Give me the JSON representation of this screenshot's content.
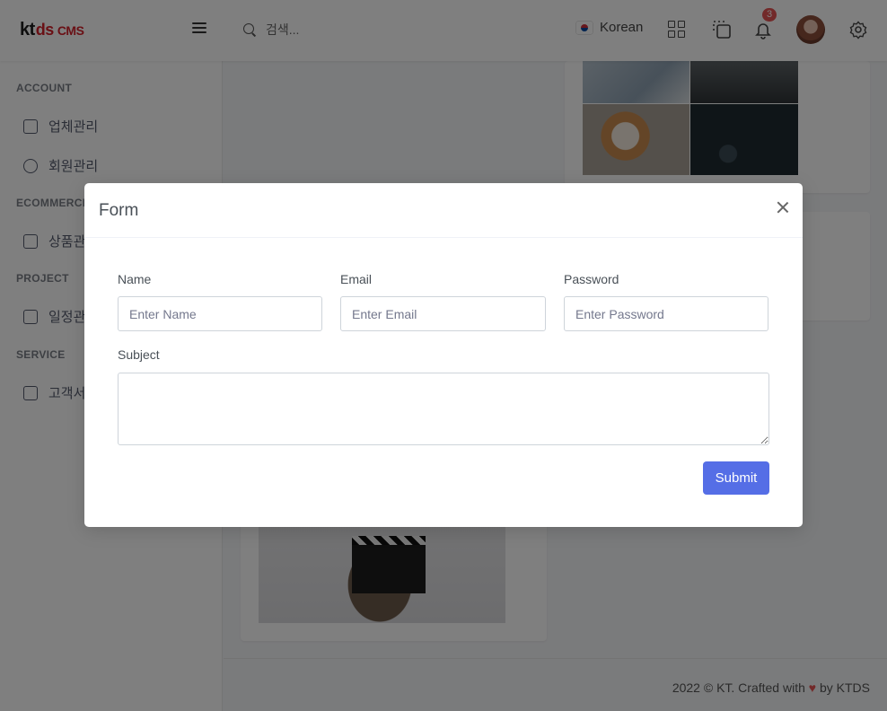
{
  "app": {
    "logo": {
      "kt": "kt",
      "ds": "ds",
      "cms": "CMS"
    },
    "accent": "#556ee6",
    "brand": "#d5202b"
  },
  "header": {
    "search_placeholder": "검색...",
    "language": "Korean",
    "notification_count": "3"
  },
  "sidebar": {
    "sections": [
      {
        "title": "ACCOUNT",
        "items": [
          {
            "label": "업체관리",
            "icon": "store-icon"
          },
          {
            "label": "회원관리",
            "icon": "user-circle-icon"
          }
        ]
      },
      {
        "title": "ECOMMERCE",
        "items": [
          {
            "label": "상품관리",
            "icon": "store-icon"
          }
        ]
      },
      {
        "title": "PROJECT",
        "items": [
          {
            "label": "일정관리",
            "icon": "calendar-icon"
          }
        ]
      },
      {
        "title": "SERVICE",
        "items": [
          {
            "label": "고객서비스",
            "icon": "newspaper-icon"
          }
        ]
      }
    ]
  },
  "modal": {
    "title": "Form",
    "fields": {
      "name": {
        "label": "Name",
        "placeholder": "Enter Name"
      },
      "email": {
        "label": "Email",
        "placeholder": "Enter Email"
      },
      "password": {
        "label": "Password",
        "placeholder": "Enter Password"
      },
      "subject": {
        "label": "Subject"
      }
    },
    "submit_label": "Submit"
  },
  "footer": {
    "prefix": "2022 © KT. Crafted with",
    "heart": "♥",
    "suffix": "by KTDS"
  }
}
